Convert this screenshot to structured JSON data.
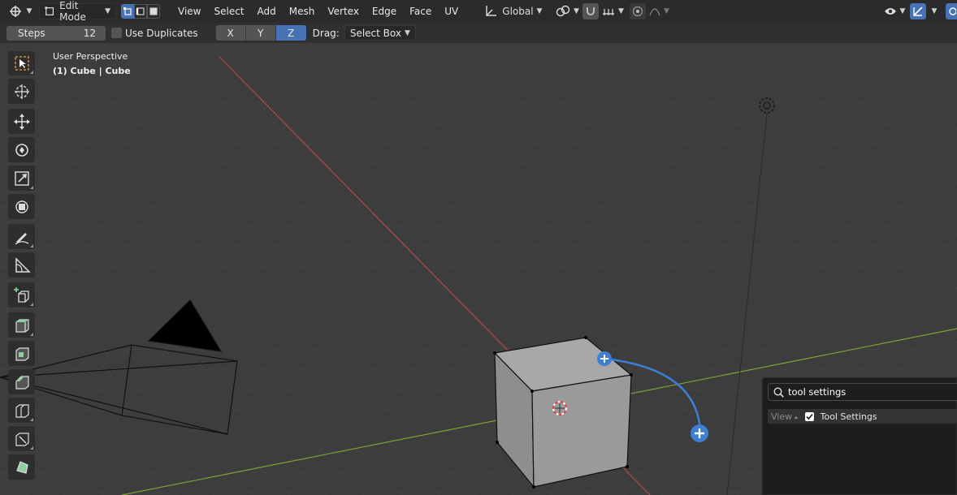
{
  "header": {
    "mode": "Edit Mode",
    "menus": [
      "View",
      "Select",
      "Add",
      "Mesh",
      "Vertex",
      "Edge",
      "Face",
      "UV"
    ],
    "orientation": "Global",
    "accent": "#4772b3"
  },
  "tool_settings": {
    "steps_label": "Steps",
    "steps_value": "12",
    "use_duplicates": "Use Duplicates",
    "axes": [
      "X",
      "Y",
      "Z"
    ],
    "active_axis": "Z",
    "drag_label": "Drag:",
    "drag_value": "Select Box"
  },
  "viewport": {
    "perspective": "User Perspective",
    "object": "(1) Cube | Cube"
  },
  "tools": [
    "select-box-icon",
    "cursor-icon",
    "move-icon",
    "rotate-icon",
    "scale-icon",
    "transform-icon",
    "annotate-icon",
    "measure-icon",
    "add-cube-icon",
    "extrude-icon",
    "inset-icon",
    "bevel-icon",
    "loop-cut-icon",
    "knife-icon",
    "poly-build-icon"
  ],
  "search": {
    "query": "tool settings",
    "result_context": "View",
    "result_label": "Tool Settings"
  }
}
